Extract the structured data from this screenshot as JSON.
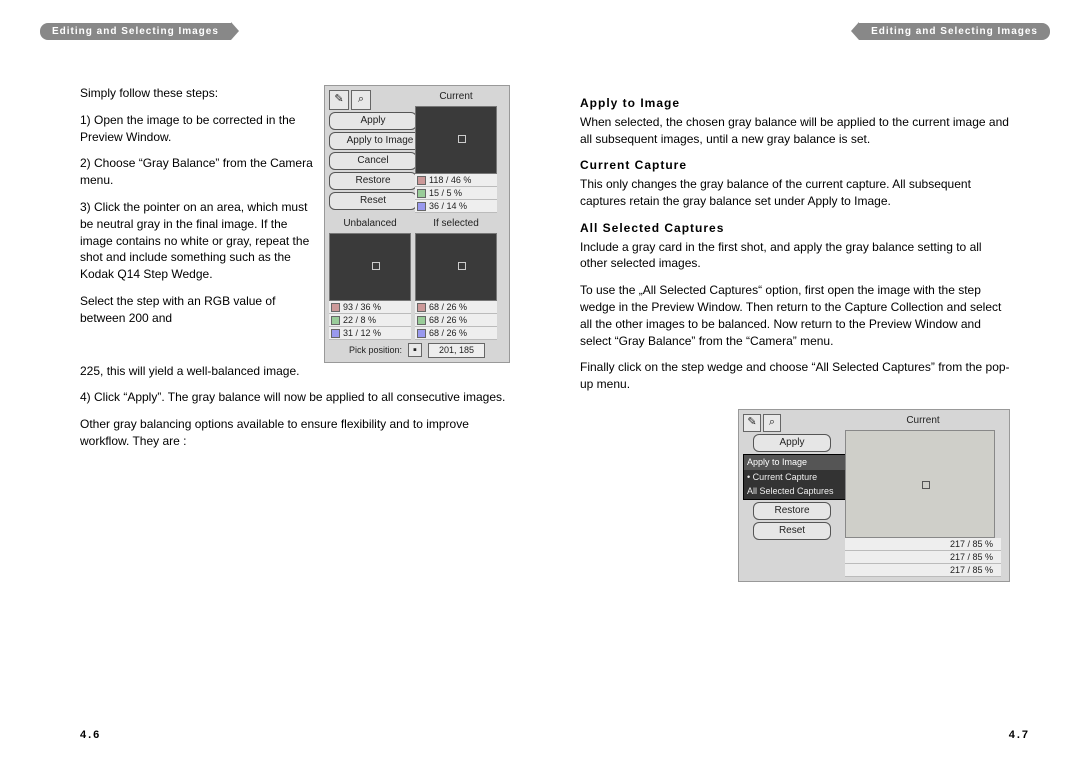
{
  "header": {
    "title": "Editing and Selecting Images"
  },
  "left": {
    "intro": "Simply follow these steps:",
    "step1": "1) Open the image to be corrected in the Preview Window.",
    "step2": "2) Choose “Gray Balance” from the Camera menu.",
    "step3": "3) Click the pointer on an area, which must be neutral gray in the final image. If the image contains no white or gray, repeat the shot and include something such as the Kodak Q14 Step Wedge.",
    "step3b": "Select the step with an RGB value of between 200 and",
    "step3c": "225, this will yield a well-balanced image.",
    "step4": "4) Click “Apply”. The gray balance will now be applied to all consecutive images.",
    "para_other": "Other gray balancing options available to ensure flexibility and to improve workflow. They are :",
    "pagenum": "4.6",
    "fig": {
      "title_current": "Current",
      "title_unbalanced": "Unbalanced",
      "title_ifselected": "If selected",
      "btn_apply": "Apply",
      "btn_apply_to_image": "Apply to Image",
      "btn_cancel": "Cancel",
      "btn_restore": "Restore",
      "btn_reset": "Reset",
      "cur_r": "118 / 46 %",
      "cur_g": "15 / 5 %",
      "cur_b": "36 / 14 %",
      "unb_r": "93 / 36 %",
      "unb_g": "22 / 8 %",
      "unb_b": "31 / 12 %",
      "sel_r": "68 / 26 %",
      "sel_g": "68 / 26 %",
      "sel_b": "68 / 26 %",
      "pick_label": "Pick position:",
      "pick_val": "201, 185"
    }
  },
  "right": {
    "h_apply": "Apply to Image",
    "p_apply": "When selected, the chosen gray balance will be applied to the current image and all subsequent images, until a new gray balance is set.",
    "h_current": "Current Capture",
    "p_current": "This only changes the gray balance of the current capture. All subsequent captures retain the gray balance set under Apply to Image.",
    "h_all": "All Selected Captures",
    "p_all1": "Include a gray card in the first shot, and apply the gray balance setting to all other selected images.",
    "p_all2": "To use the „All Selected Captures“ option, first open the image with the step wedge in the Preview Window. Then return to the Capture Collection and select all the other images to be balanced. Now return to the Preview Window and select “Gray Balance” from the “Camera” menu.",
    "p_all3": "Finally click on the step wedge and choose “All Selected Captures” from the pop-up menu.",
    "pagenum": "4.7",
    "fig": {
      "title_current": "Current",
      "btn_apply": "Apply",
      "btn_apply_to_image": "Apply to Image",
      "dd_current": "Current Capture",
      "dd_all": "All Selected Captures",
      "btn_restore": "Restore",
      "btn_reset": "Reset",
      "val_r": "217 / 85 %",
      "val_g": "217 / 85 %",
      "val_b": "217 / 85 %"
    }
  }
}
